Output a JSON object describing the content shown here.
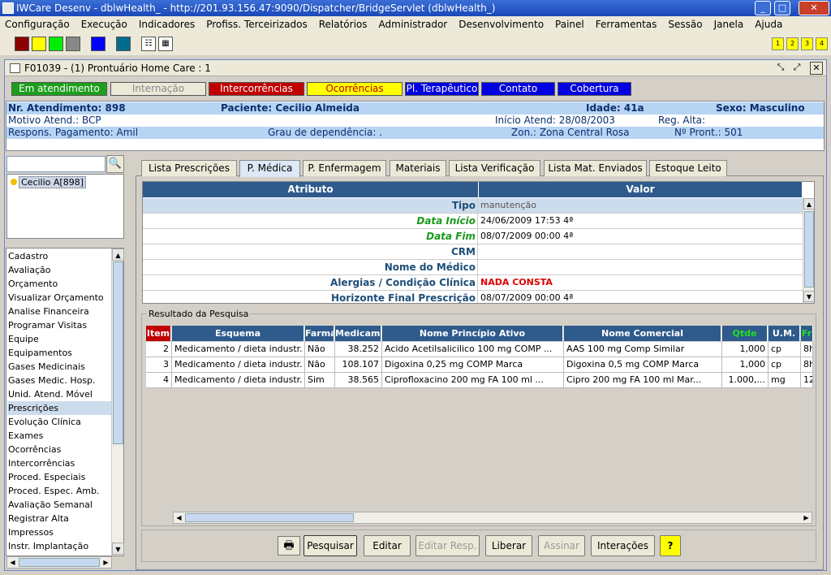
{
  "window": {
    "title": "IWCare Desenv - dblwHealth_ - http://201.93.156.47:9090/Dispatcher/BridgeServlet (dblwHealth_)"
  },
  "menu": [
    "Configuração",
    "Execução",
    "Indicadores",
    "Profiss. Terceirizados",
    "Relatórios",
    "Administrador",
    "Desenvolvimento",
    "Painel",
    "Ferramentas",
    "Sessão",
    "Janela",
    "Ajuda"
  ],
  "toolbar": {
    "swatches": [
      "#8b0000",
      "#ffff00",
      "#00ee00",
      "#888888",
      "#0000ff",
      "#006c8e"
    ],
    "number_buttons": [
      "1",
      "2",
      "3",
      "4"
    ]
  },
  "frame": {
    "title": "F01039 - (1) Prontuário Home Care : 1"
  },
  "status_tabs": [
    {
      "label": "Em atendimento",
      "bg": "#1d9e1d",
      "fg": "#ffffff"
    },
    {
      "label": "Internação",
      "bg": "#ece9d8",
      "fg": "#888888"
    },
    {
      "label": "Intercorrências",
      "bg": "#c00000",
      "fg": "#ffffff"
    },
    {
      "label": "Ocorrências",
      "bg": "#ffff00",
      "fg": "#c00000"
    },
    {
      "label": "Pl. Terapêutico",
      "bg": "#0000e0",
      "fg": "#ffffff"
    },
    {
      "label": "Contato",
      "bg": "#0000e0",
      "fg": "#ffffff"
    },
    {
      "label": "Cobertura",
      "bg": "#0000e0",
      "fg": "#ffffff"
    }
  ],
  "patient": {
    "atendimento": "Nr. Atendimento: 898",
    "paciente": "Paciente: Cecilio Almeida",
    "idade": "Idade: 41a",
    "sexo": "Sexo: Masculino",
    "motivo": "Motivo Atend.: BCP",
    "inicio": "Início Atend: 28/08/2003",
    "reg_alta": "Reg. Alta:",
    "pagamento": "Respons. Pagamento: Amil",
    "grau": "Grau de dependência: .",
    "zona": "Zon.: Zona Central Rosa",
    "pront": "Nº Pront.: 501"
  },
  "tree": {
    "item": "Cecilio A[898]"
  },
  "nav": {
    "items": [
      "Cadastro",
      "Avaliação",
      "Orçamento",
      "Visualizar Orçamento",
      "Analise Financeira",
      "Programar Visitas",
      "Equipe",
      "Equipamentos",
      "Gases Medicinais",
      "Gases Medic. Hosp.",
      "Unid. Atend. Móvel",
      "Prescrições",
      "Evolução Clínica",
      "Exames",
      "Ocorrências",
      "Intercorrências",
      "Proced. Especiais",
      "Proced. Espec. Amb.",
      "Avaliação Semanal",
      "Registrar Alta",
      "Impressos",
      "Instr. Implantação"
    ],
    "selected_index": 11
  },
  "tabs": [
    "Lista Prescrições",
    "P. Médica",
    "P. Enfermagem",
    "Materiais",
    "Lista Verificação",
    "Lista Mat. Enviados",
    "Estoque Leito"
  ],
  "active_tab": 1,
  "attributes": {
    "headers": [
      "Atributo",
      "Valor"
    ],
    "rows": [
      {
        "label": "Tipo",
        "value": "manutenção",
        "label_color": "#1e4e78",
        "value_color": "#555555",
        "highlight": true
      },
      {
        "label": "Data Início",
        "value": "24/06/2009 17:53 4ª",
        "label_color": "#1a9a1a",
        "value_color": "#000000",
        "italic": true
      },
      {
        "label": "Data Fim",
        "value": "08/07/2009 00:00 4ª",
        "label_color": "#1a9a1a",
        "value_color": "#000000",
        "italic": true
      },
      {
        "label": "CRM",
        "value": "",
        "label_color": "#1e4e78",
        "value_color": "#000000"
      },
      {
        "label": "Nome do Médico",
        "value": "",
        "label_color": "#1e4e78",
        "value_color": "#000000"
      },
      {
        "label": "Alergias / Condição Clínica",
        "value": "NADA CONSTA",
        "label_color": "#1e4e78",
        "value_color": "#dd0000",
        "bold_value": true
      },
      {
        "label": "Horizonte Final Prescrição",
        "value": "08/07/2009 00:00 4ª",
        "label_color": "#1e4e78",
        "value_color": "#000000"
      }
    ]
  },
  "results": {
    "legend": "Resultado da Pesquisa",
    "headers": [
      {
        "label": "Item",
        "bg": "#c00000",
        "fg": "#ffffff"
      },
      {
        "label": "Esquema",
        "bg": "#2e5b8c",
        "fg": "#ffffff"
      },
      {
        "label": "Farmá",
        "bg": "#2e5b8c",
        "fg": "#ffffff"
      },
      {
        "label": "Medicame",
        "bg": "#2e5b8c",
        "fg": "#ffffff"
      },
      {
        "label": "Nome Princípio Ativo",
        "bg": "#2e5b8c",
        "fg": "#ffffff"
      },
      {
        "label": "Nome Comercial",
        "bg": "#2e5b8c",
        "fg": "#ffffff"
      },
      {
        "label": "Qtde",
        "bg": "#2e5b8c",
        "fg": "#22dd22"
      },
      {
        "label": "U.M.",
        "bg": "#2e5b8c",
        "fg": "#ffffff"
      },
      {
        "label": "Fr",
        "bg": "#2e5b8c",
        "fg": "#22dd22"
      }
    ],
    "rows": [
      [
        "2",
        "Medicamento / dieta industr.",
        "Não",
        "38.252",
        "Acido Acetilsalicilico    100 mg  COMP ...",
        "AAS 100 mg Comp Similar",
        "1,000",
        "cp",
        "8h"
      ],
      [
        "3",
        "Medicamento / dieta industr.",
        "Não",
        "108.107",
        "Digoxina    0,25 mg  COMP       Marca",
        "Digoxina    0,5 mg  COMP      Marca",
        "1,000",
        "cp",
        "8h"
      ],
      [
        "4",
        "Medicamento / dieta industr.",
        "Sim",
        "38.565",
        "Ciprofloxacino    200 mg  FA  100 ml  ...",
        "Cipro    200 mg  FA  100 ml    Mar...",
        "1.000,...",
        "mg",
        "12"
      ]
    ]
  },
  "buttons": [
    {
      "label": "Pesquisar",
      "disabled": false
    },
    {
      "label": "Editar",
      "disabled": false
    },
    {
      "label": "Editar Resp.",
      "disabled": true
    },
    {
      "label": "Liberar",
      "disabled": false
    },
    {
      "label": "Assinar",
      "disabled": true
    },
    {
      "label": "Interações",
      "disabled": false
    },
    {
      "label": "?",
      "disabled": false
    }
  ]
}
